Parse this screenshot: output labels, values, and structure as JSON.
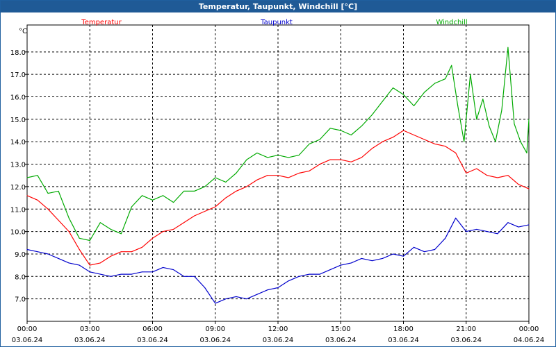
{
  "window": {
    "title": "Temperatur, Taupunkt, Windchill [°C]"
  },
  "chart_data": {
    "type": "line",
    "title": "Temperatur, Taupunkt, Windchill [°C]",
    "ylabel": "°C",
    "xlabel": "",
    "ylim": [
      6.0,
      19.2
    ],
    "xlim": [
      0,
      24
    ],
    "y_ticks": [
      "7.0",
      "8.0",
      "9.0",
      "10.0",
      "11.0",
      "12.0",
      "13.0",
      "14.0",
      "15.0",
      "16.0",
      "17.0",
      "18.0"
    ],
    "x_ticks": [
      {
        "time": "00:00",
        "date": "03.06.24"
      },
      {
        "time": "03:00",
        "date": "03.06.24"
      },
      {
        "time": "06:00",
        "date": "03.06.24"
      },
      {
        "time": "09:00",
        "date": "03.06.24"
      },
      {
        "time": "12:00",
        "date": "03.06.24"
      },
      {
        "time": "15:00",
        "date": "03.06.24"
      },
      {
        "time": "18:00",
        "date": "03.06.24"
      },
      {
        "time": "21:00",
        "date": "03.06.24"
      },
      {
        "time": "00:00",
        "date": "04.06.24"
      }
    ],
    "grid": true,
    "legend_position": "top",
    "x_unit": "hours",
    "series": [
      {
        "name": "Temperatur",
        "color": "#ff0000",
        "points": [
          [
            0,
            11.6
          ],
          [
            0.5,
            11.4
          ],
          [
            1,
            11.0
          ],
          [
            1.5,
            10.5
          ],
          [
            2,
            10.0
          ],
          [
            2.5,
            9.2
          ],
          [
            3,
            8.5
          ],
          [
            3.5,
            8.6
          ],
          [
            4,
            8.9
          ],
          [
            4.5,
            9.1
          ],
          [
            5,
            9.1
          ],
          [
            5.5,
            9.3
          ],
          [
            6,
            9.7
          ],
          [
            6.5,
            10.0
          ],
          [
            7,
            10.1
          ],
          [
            7.5,
            10.4
          ],
          [
            8,
            10.7
          ],
          [
            8.5,
            10.9
          ],
          [
            9,
            11.1
          ],
          [
            9.5,
            11.5
          ],
          [
            10,
            11.8
          ],
          [
            10.5,
            12.0
          ],
          [
            11,
            12.3
          ],
          [
            11.5,
            12.5
          ],
          [
            12,
            12.5
          ],
          [
            12.5,
            12.4
          ],
          [
            13,
            12.6
          ],
          [
            13.5,
            12.7
          ],
          [
            14,
            13.0
          ],
          [
            14.5,
            13.2
          ],
          [
            15,
            13.2
          ],
          [
            15.5,
            13.1
          ],
          [
            16,
            13.3
          ],
          [
            16.5,
            13.7
          ],
          [
            17,
            14.0
          ],
          [
            17.5,
            14.2
          ],
          [
            18,
            14.5
          ],
          [
            18.5,
            14.3
          ],
          [
            19,
            14.1
          ],
          [
            19.5,
            13.9
          ],
          [
            20,
            13.8
          ],
          [
            20.5,
            13.5
          ],
          [
            21,
            12.6
          ],
          [
            21.5,
            12.8
          ],
          [
            22,
            12.5
          ],
          [
            22.5,
            12.4
          ],
          [
            23,
            12.5
          ],
          [
            23.5,
            12.1
          ],
          [
            24,
            11.9
          ]
        ]
      },
      {
        "name": "Taupunkt",
        "color": "#0000cc",
        "points": [
          [
            0,
            9.2
          ],
          [
            0.5,
            9.1
          ],
          [
            1,
            9.0
          ],
          [
            1.5,
            8.8
          ],
          [
            2,
            8.6
          ],
          [
            2.5,
            8.5
          ],
          [
            3,
            8.2
          ],
          [
            3.5,
            8.1
          ],
          [
            4,
            8.0
          ],
          [
            4.5,
            8.1
          ],
          [
            5,
            8.1
          ],
          [
            5.5,
            8.2
          ],
          [
            6,
            8.2
          ],
          [
            6.5,
            8.4
          ],
          [
            7,
            8.3
          ],
          [
            7.5,
            8.0
          ],
          [
            8,
            8.0
          ],
          [
            8.5,
            7.5
          ],
          [
            9,
            6.8
          ],
          [
            9.5,
            7.0
          ],
          [
            10,
            7.1
          ],
          [
            10.5,
            7.0
          ],
          [
            11,
            7.2
          ],
          [
            11.5,
            7.4
          ],
          [
            12,
            7.5
          ],
          [
            12.5,
            7.8
          ],
          [
            13,
            8.0
          ],
          [
            13.5,
            8.1
          ],
          [
            14,
            8.1
          ],
          [
            14.5,
            8.3
          ],
          [
            15,
            8.5
          ],
          [
            15.5,
            8.6
          ],
          [
            16,
            8.8
          ],
          [
            16.5,
            8.7
          ],
          [
            17,
            8.8
          ],
          [
            17.5,
            9.0
          ],
          [
            18,
            8.9
          ],
          [
            18.5,
            9.3
          ],
          [
            19,
            9.1
          ],
          [
            19.5,
            9.2
          ],
          [
            20,
            9.7
          ],
          [
            20.5,
            10.6
          ],
          [
            21,
            10.0
          ],
          [
            21.5,
            10.1
          ],
          [
            22,
            10.0
          ],
          [
            22.5,
            9.9
          ],
          [
            23,
            10.4
          ],
          [
            23.5,
            10.2
          ],
          [
            24,
            10.3
          ]
        ]
      },
      {
        "name": "Windchill",
        "color": "#00aa00",
        "points": [
          [
            0,
            12.4
          ],
          [
            0.5,
            12.5
          ],
          [
            1,
            11.7
          ],
          [
            1.5,
            11.8
          ],
          [
            2,
            10.6
          ],
          [
            2.5,
            9.7
          ],
          [
            3,
            9.6
          ],
          [
            3.5,
            10.4
          ],
          [
            4,
            10.1
          ],
          [
            4.5,
            9.9
          ],
          [
            5,
            11.1
          ],
          [
            5.5,
            11.6
          ],
          [
            6,
            11.4
          ],
          [
            6.5,
            11.6
          ],
          [
            7,
            11.3
          ],
          [
            7.5,
            11.8
          ],
          [
            8,
            11.8
          ],
          [
            8.5,
            12.0
          ],
          [
            9,
            12.4
          ],
          [
            9.5,
            12.2
          ],
          [
            10,
            12.6
          ],
          [
            10.5,
            13.2
          ],
          [
            11,
            13.5
          ],
          [
            11.5,
            13.3
          ],
          [
            12,
            13.4
          ],
          [
            12.5,
            13.3
          ],
          [
            13,
            13.4
          ],
          [
            13.5,
            13.9
          ],
          [
            14,
            14.1
          ],
          [
            14.5,
            14.6
          ],
          [
            15,
            14.5
          ],
          [
            15.5,
            14.3
          ],
          [
            16,
            14.7
          ],
          [
            16.5,
            15.2
          ],
          [
            17,
            15.8
          ],
          [
            17.5,
            16.4
          ],
          [
            18,
            16.1
          ],
          [
            18.5,
            15.6
          ],
          [
            19,
            16.2
          ],
          [
            19.5,
            16.6
          ],
          [
            20,
            16.8
          ],
          [
            20.3,
            17.4
          ],
          [
            20.6,
            15.6
          ],
          [
            20.9,
            14.0
          ],
          [
            21.2,
            17.0
          ],
          [
            21.5,
            15.0
          ],
          [
            21.8,
            15.9
          ],
          [
            22.1,
            14.7
          ],
          [
            22.4,
            14.0
          ],
          [
            22.7,
            15.4
          ],
          [
            23,
            18.2
          ],
          [
            23.3,
            14.8
          ],
          [
            23.6,
            14.0
          ],
          [
            23.9,
            13.5
          ],
          [
            24,
            15.0
          ]
        ]
      }
    ]
  }
}
